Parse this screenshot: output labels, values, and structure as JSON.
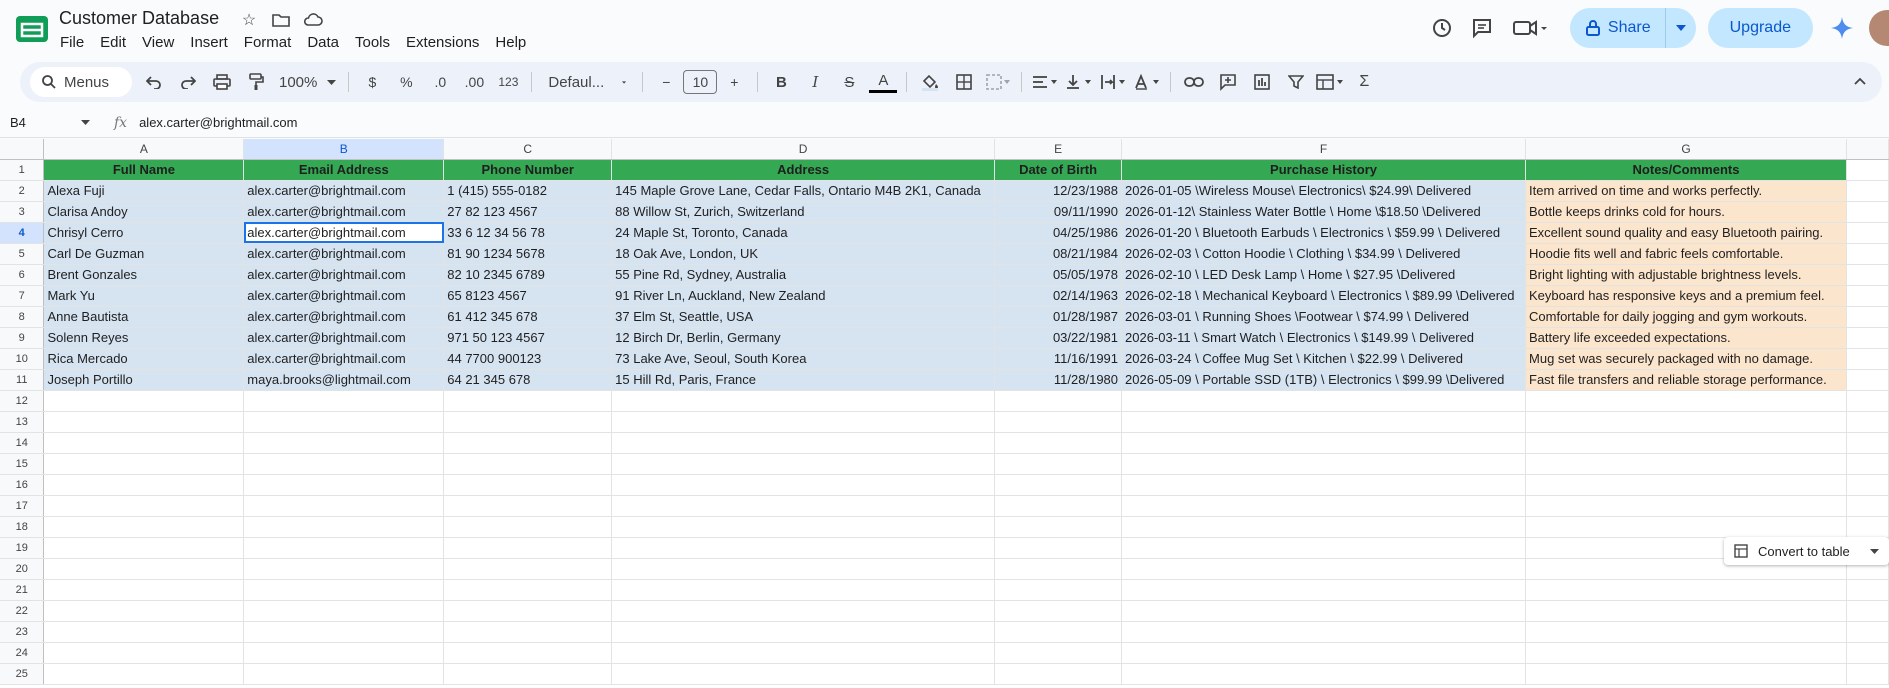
{
  "app": {
    "title": "Customer Database",
    "menu": [
      "File",
      "Edit",
      "View",
      "Insert",
      "Format",
      "Data",
      "Tools",
      "Extensions",
      "Help"
    ],
    "share_label": "Share",
    "upgrade_label": "Upgrade"
  },
  "toolbar": {
    "search_label": "Menus",
    "zoom": "100%",
    "currency": "$",
    "percent": "%",
    "dec_decrease": ".0",
    "dec_increase": ".00",
    "number_format": "123",
    "font": "Defaul...",
    "font_size": "10",
    "bold": "B",
    "italic": "I",
    "strike": "S",
    "text_color": "A",
    "sum": "Σ"
  },
  "formula_bar": {
    "cell_ref": "B4",
    "fx": "fx",
    "value": "alex.carter@brightmail.com"
  },
  "sheet": {
    "column_letters": [
      "A",
      "B",
      "C",
      "D",
      "E",
      "F",
      "G"
    ],
    "row_numbers": [
      "1",
      "2",
      "3",
      "4",
      "5",
      "6",
      "7",
      "8",
      "9",
      "10",
      "11",
      "12",
      "13",
      "14",
      "15",
      "16",
      "17",
      "18",
      "19",
      "20",
      "21",
      "22",
      "23",
      "24",
      "25"
    ],
    "headers": [
      "Full Name",
      "Email Address",
      "Phone Number",
      "Address",
      "Date of Birth",
      "Purchase History",
      "Notes/Comments"
    ],
    "rows": [
      [
        "Alexa Fuji",
        "alex.carter@brightmail.com",
        "1 (415) 555-0182",
        "145 Maple Grove Lane, Cedar Falls, Ontario M4B 2K1, Canada",
        "12/23/1988",
        "2026-01-05 \\Wireless Mouse\\ Electronics\\ $24.99\\ Delivered",
        "Item arrived on time and works perfectly."
      ],
      [
        "Clarisa Andoy",
        "alex.carter@brightmail.com",
        "27 82 123 4567",
        "88 Willow St, Zurich, Switzerland",
        "09/11/1990",
        "2026-01-12\\ Stainless Water Bottle \\ Home \\$18.50 \\Delivered",
        "Bottle keeps drinks cold for hours."
      ],
      [
        "Chrisyl Cerro",
        "alex.carter@brightmail.com",
        "33 6 12 34 56 78",
        "24 Maple St, Toronto, Canada",
        "04/25/1986",
        "2026-01-20 \\ Bluetooth Earbuds \\ Electronics \\ $59.99 \\ Delivered",
        "Excellent sound quality and easy Bluetooth pairing."
      ],
      [
        "Carl De Guzman",
        "alex.carter@brightmail.com",
        "81 90 1234 5678",
        "18 Oak Ave, London, UK",
        "08/21/1984",
        "2026-02-03 \\ Cotton Hoodie \\ Clothing \\ $34.99 \\ Delivered",
        "Hoodie fits well and fabric feels comfortable."
      ],
      [
        "Brent Gonzales",
        "alex.carter@brightmail.com",
        "82 10 2345 6789",
        "55 Pine Rd, Sydney, Australia",
        "05/05/1978",
        "2026-02-10 \\ LED Desk Lamp \\ Home \\ $27.95 \\Delivered",
        "Bright lighting with adjustable brightness levels."
      ],
      [
        "Mark Yu",
        "alex.carter@brightmail.com",
        "65 8123 4567",
        "91 River Ln, Auckland, New Zealand",
        "02/14/1963",
        "2026-02-18 \\ Mechanical Keyboard \\ Electronics \\ $89.99 \\Delivered",
        "Keyboard has responsive keys and a premium feel."
      ],
      [
        "Anne Bautista",
        "alex.carter@brightmail.com",
        "61 412 345 678",
        "37 Elm St, Seattle, USA",
        "01/28/1987",
        "2026-03-01 \\ Running Shoes \\Footwear \\ $74.99 \\ Delivered",
        "Comfortable for daily jogging and gym workouts."
      ],
      [
        "Solenn Reyes",
        "alex.carter@brightmail.com",
        "971 50 123 4567",
        "12 Birch Dr, Berlin, Germany",
        "03/22/1981",
        "2026-03-11 \\ Smart Watch \\ Electronics \\ $149.99 \\ Delivered",
        "Battery life exceeded expectations."
      ],
      [
        "Rica Mercado",
        "alex.carter@brightmail.com",
        "44 7700 900123",
        "73 Lake Ave, Seoul, South Korea",
        "11/16/1991",
        "2026-03-24 \\ Coffee Mug Set \\ Kitchen \\ $22.99 \\ Delivered",
        "Mug set was securely packaged with no damage."
      ],
      [
        "Joseph Portillo",
        "maya.brooks@lightmail.com",
        "64 21 345 678",
        "15 Hill Rd, Paris, France",
        "11/28/1980",
        "2026-05-09 \\ Portable SSD (1TB) \\ Electronics \\ $99.99 \\Delivered",
        "Fast file transfers and reliable storage performance."
      ]
    ],
    "convert_label": "Convert to table"
  },
  "colors": {
    "header_fill": "#34a853",
    "data_fill": "#d6e3f1",
    "notes_fill": "#fce5cd",
    "accent": "#0b57d0"
  }
}
